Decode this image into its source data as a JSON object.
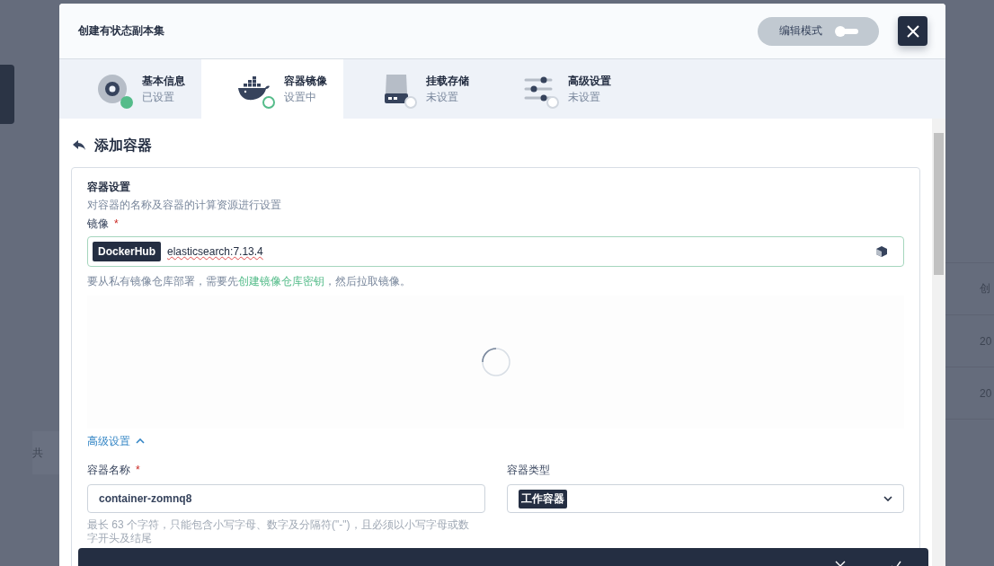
{
  "background_page": {
    "texts": [
      {
        "kind": "left",
        "text": "共"
      },
      {
        "kind": "right",
        "text": "创"
      },
      {
        "kind": "right",
        "text": "20"
      },
      {
        "kind": "right",
        "text": "20"
      }
    ]
  },
  "dialog": {
    "title": "创建有状态副本集",
    "edit_mode": {
      "label": "编辑模式",
      "on": false
    }
  },
  "steps": [
    {
      "kind": "info",
      "title": "基本信息",
      "status_text": "已设置",
      "completed": true,
      "selected": false
    },
    {
      "kind": "image",
      "title": "容器镜像",
      "status_text": "设置中",
      "completed": false,
      "selected": true
    },
    {
      "kind": "storage",
      "title": "挂载存储",
      "status_text": "未设置",
      "completed": false,
      "selected": false
    },
    {
      "kind": "advanced",
      "title": "高级设置",
      "status_text": "未设置",
      "completed": false,
      "selected": false
    }
  ],
  "section": {
    "title": "添加容器"
  },
  "card": {
    "title": "容器设置",
    "description": "对容器的名称及容器的计算资源进行设置",
    "image_field": {
      "label": "镜像",
      "required_mark": "*",
      "registry": "DockerHub",
      "value": "elasticsearch:7.13.4"
    },
    "hint": {
      "before": "要从私有镜像仓库部署，需要先",
      "link": "创建镜像仓库密钥",
      "after": "，然后拉取镜像。"
    },
    "loading": true,
    "advanced_toggle": {
      "label": "高级设置",
      "expanded": true
    },
    "name_field": {
      "label": "容器名称",
      "required_mark": "*",
      "value": "container-zomnq8",
      "hint": "最长 63 个字符，只能包含小写字母、数字及分隔符(\"-\")，且必须以小写字母或数字开头及结尾"
    },
    "type_field": {
      "label": "容器类型",
      "value": "工作容器"
    }
  }
}
